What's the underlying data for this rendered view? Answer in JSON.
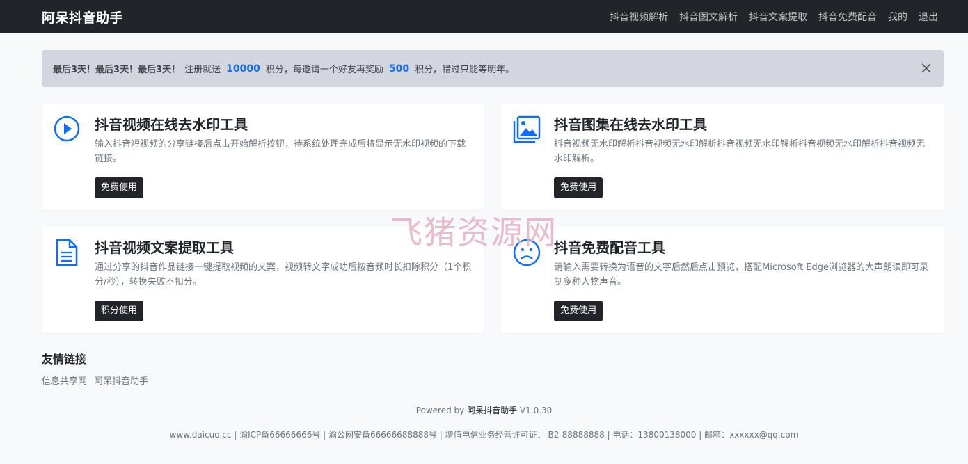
{
  "brand": "阿呆抖音助手",
  "nav": [
    "抖音视频解析",
    "抖音图文解析",
    "抖音文案提取",
    "抖音免费配音",
    "我的",
    "退出"
  ],
  "alert": {
    "bold": "最后3天！最后3天！最后3天！",
    "text1": "注册就送",
    "num1": "10000",
    "text2": "积分，每邀请一个好友再奖励",
    "num2": "500",
    "text3": "积分，错过只能等明年。"
  },
  "cards": [
    {
      "title": "抖音视频在线去水印工具",
      "desc": "输入抖音短视频的分享链接后点击开始解析按钮，待系统处理完成后将显示无水印视频的下载链接。",
      "button": "免费使用",
      "icon": "play-circle-icon"
    },
    {
      "title": "抖音图集在线去水印工具",
      "desc": "抖音视频无水印解析抖音视频无水印解析抖音视频无水印解析抖音视频无水印解析抖音视频无水印解析。",
      "button": "免费使用",
      "icon": "images-icon"
    },
    {
      "title": "抖音视频文案提取工具",
      "desc": "通过分享的抖音作品链接一键提取视频的文案，视频转文字成功后按音频时长扣除积分（1个积分/秒），转换失败不扣分。",
      "button": "积分使用",
      "icon": "document-icon"
    },
    {
      "title": "抖音免费配音工具",
      "desc": "请输入需要转换为语音的文字后然后点击预览，搭配Microsoft Edge浏览器的大声朗读即可录制多种人物声音。",
      "button": "免费使用",
      "icon": "frown-face-icon"
    }
  ],
  "links": {
    "title": "友情链接",
    "items": [
      "信息共享网",
      "阿呆抖音助手"
    ]
  },
  "footer": {
    "powered_prefix": "Powered by",
    "powered_name": "阿呆抖音助手",
    "version": "V1.0.30",
    "copyright": "www.daicuo.cc | 渝ICP备66666666号 | 渝公网安备66666688888号 | 增值电信业务经营许可证： B2-88888888 | 电话：13800138000 | 邮箱：xxxxxx@qq.com"
  },
  "watermark": "飞猪资源网",
  "colors": {
    "navbar": "#212529",
    "accent": "#0d6efd",
    "alert_bg": "#d3d6de"
  }
}
